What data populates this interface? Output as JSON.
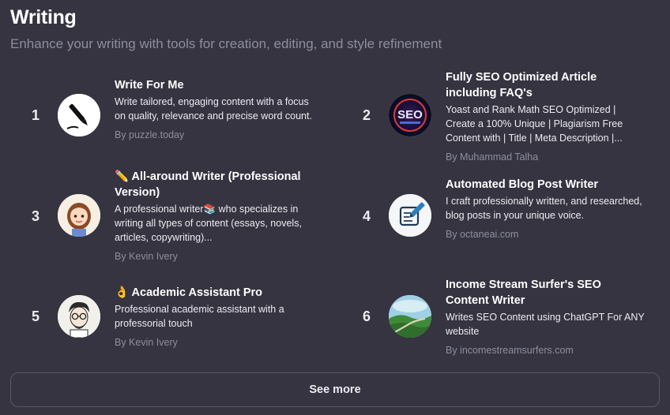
{
  "section": {
    "title": "Writing",
    "subtitle": "Enhance your writing with tools for creation, editing, and style refinement"
  },
  "items": [
    {
      "rank": "1",
      "name": "Write For Me",
      "desc": "Write tailored, engaging content with a focus on quality, relevance and precise word count.",
      "by": "By puzzle.today",
      "icon": "pen-icon"
    },
    {
      "rank": "2",
      "name": "Fully SEO Optimized Article including FAQ's",
      "desc": "Yoast and Rank Math SEO Optimized | Create a 100% Unique | Plagiarism Free Content with | Title | Meta Description |...",
      "by": "By Muhammad Talha",
      "icon": "seo-logo-icon"
    },
    {
      "rank": "3",
      "name": "✏️ All-around Writer (Professional Version)",
      "desc": "A professional writer📚 who specializes in writing all types of content (essays, novels, articles, copywriting)...",
      "by": "By Kevin Ivery",
      "icon": "writer-girl-avatar-icon"
    },
    {
      "rank": "4",
      "name": "Automated Blog Post Writer",
      "desc": "I craft professionally written, and researched, blog posts in your unique voice.",
      "by": "By octaneai.com",
      "icon": "blog-edit-icon"
    },
    {
      "rank": "5",
      "name": "👌 Academic Assistant Pro",
      "desc": "Professional academic assistant with a professorial touch",
      "by": "By Kevin Ivery",
      "icon": "professor-avatar-icon"
    },
    {
      "rank": "6",
      "name": "Income Stream Surfer's SEO Content Writer",
      "desc": "Writes SEO Content using ChatGPT For ANY website",
      "by": "By incomestreamsurfers.com",
      "icon": "landscape-icon"
    }
  ],
  "see_more": "See more",
  "colors": {
    "background": "#353440",
    "muted_text": "#8e8ea0",
    "border": "#565869"
  }
}
